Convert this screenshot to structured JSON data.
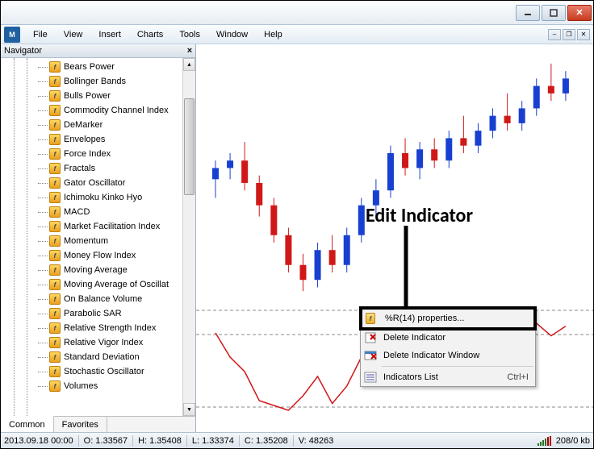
{
  "menu": {
    "file": "File",
    "view": "View",
    "insert": "Insert",
    "charts": "Charts",
    "tools": "Tools",
    "window": "Window",
    "help": "Help"
  },
  "navigator": {
    "title": "Navigator",
    "tabs": {
      "common": "Common",
      "favorites": "Favorites"
    },
    "items": [
      "Bears Power",
      "Bollinger Bands",
      "Bulls Power",
      "Commodity Channel Index",
      "DeMarker",
      "Envelopes",
      "Force Index",
      "Fractals",
      "Gator Oscillator",
      "Ichimoku Kinko Hyo",
      "MACD",
      "Market Facilitation Index",
      "Momentum",
      "Money Flow Index",
      "Moving Average",
      "Moving Average of Oscillat",
      "On Balance Volume",
      "Parabolic SAR",
      "Relative Strength Index",
      "Relative Vigor Index",
      "Standard Deviation",
      "Stochastic Oscillator",
      "Volumes"
    ]
  },
  "context_menu": {
    "properties": "%R(14) properties...",
    "delete_indicator": "Delete Indicator",
    "delete_window": "Delete Indicator Window",
    "indicators_list": "Indicators List",
    "shortcut": "Ctrl+I"
  },
  "annotation": {
    "label": "Edit Indicator"
  },
  "statusbar": {
    "datetime": "2013.09.18 00:00",
    "open": "O: 1.33567",
    "high": "H: 1.35408",
    "low": "L: 1.33374",
    "close": "C: 1.35208",
    "volume": "V: 48263",
    "kb": "208/0 kb"
  },
  "chart_data": {
    "type": "candlestick_with_indicator",
    "main": {
      "candles": [
        {
          "o": 1.335,
          "h": 1.34,
          "l": 1.33,
          "c": 1.338,
          "color": "blue"
        },
        {
          "o": 1.338,
          "h": 1.342,
          "l": 1.335,
          "c": 1.34,
          "color": "blue"
        },
        {
          "o": 1.34,
          "h": 1.345,
          "l": 1.332,
          "c": 1.334,
          "color": "red"
        },
        {
          "o": 1.334,
          "h": 1.336,
          "l": 1.325,
          "c": 1.328,
          "color": "red"
        },
        {
          "o": 1.328,
          "h": 1.33,
          "l": 1.318,
          "c": 1.32,
          "color": "red"
        },
        {
          "o": 1.32,
          "h": 1.322,
          "l": 1.31,
          "c": 1.312,
          "color": "red"
        },
        {
          "o": 1.312,
          "h": 1.315,
          "l": 1.305,
          "c": 1.308,
          "color": "red"
        },
        {
          "o": 1.308,
          "h": 1.318,
          "l": 1.306,
          "c": 1.316,
          "color": "blue"
        },
        {
          "o": 1.316,
          "h": 1.32,
          "l": 1.31,
          "c": 1.312,
          "color": "red"
        },
        {
          "o": 1.312,
          "h": 1.322,
          "l": 1.31,
          "c": 1.32,
          "color": "blue"
        },
        {
          "o": 1.32,
          "h": 1.33,
          "l": 1.318,
          "c": 1.328,
          "color": "blue"
        },
        {
          "o": 1.328,
          "h": 1.335,
          "l": 1.325,
          "c": 1.332,
          "color": "blue"
        },
        {
          "o": 1.332,
          "h": 1.344,
          "l": 1.33,
          "c": 1.342,
          "color": "blue"
        },
        {
          "o": 1.342,
          "h": 1.346,
          "l": 1.336,
          "c": 1.338,
          "color": "red"
        },
        {
          "o": 1.338,
          "h": 1.345,
          "l": 1.335,
          "c": 1.343,
          "color": "blue"
        },
        {
          "o": 1.343,
          "h": 1.346,
          "l": 1.338,
          "c": 1.34,
          "color": "red"
        },
        {
          "o": 1.34,
          "h": 1.348,
          "l": 1.338,
          "c": 1.346,
          "color": "blue"
        },
        {
          "o": 1.346,
          "h": 1.352,
          "l": 1.342,
          "c": 1.344,
          "color": "red"
        },
        {
          "o": 1.344,
          "h": 1.35,
          "l": 1.342,
          "c": 1.348,
          "color": "blue"
        },
        {
          "o": 1.348,
          "h": 1.354,
          "l": 1.346,
          "c": 1.352,
          "color": "blue"
        },
        {
          "o": 1.352,
          "h": 1.358,
          "l": 1.348,
          "c": 1.35,
          "color": "red"
        },
        {
          "o": 1.35,
          "h": 1.356,
          "l": 1.348,
          "c": 1.354,
          "color": "blue"
        },
        {
          "o": 1.354,
          "h": 1.362,
          "l": 1.352,
          "c": 1.36,
          "color": "blue"
        },
        {
          "o": 1.36,
          "h": 1.366,
          "l": 1.356,
          "c": 1.358,
          "color": "red"
        },
        {
          "o": 1.358,
          "h": 1.364,
          "l": 1.356,
          "c": 1.362,
          "color": "blue"
        }
      ]
    },
    "indicator": {
      "name": "%R(14)",
      "type": "line",
      "color": "red",
      "levels": [
        -20,
        -80
      ],
      "values": [
        -15,
        -40,
        -55,
        -85,
        -90,
        -95,
        -80,
        -60,
        -88,
        -70,
        -40,
        -25,
        -10,
        -35,
        -15,
        -22,
        -10,
        -30,
        -12,
        -8,
        -20,
        -10,
        -5,
        -18,
        -8
      ]
    }
  }
}
